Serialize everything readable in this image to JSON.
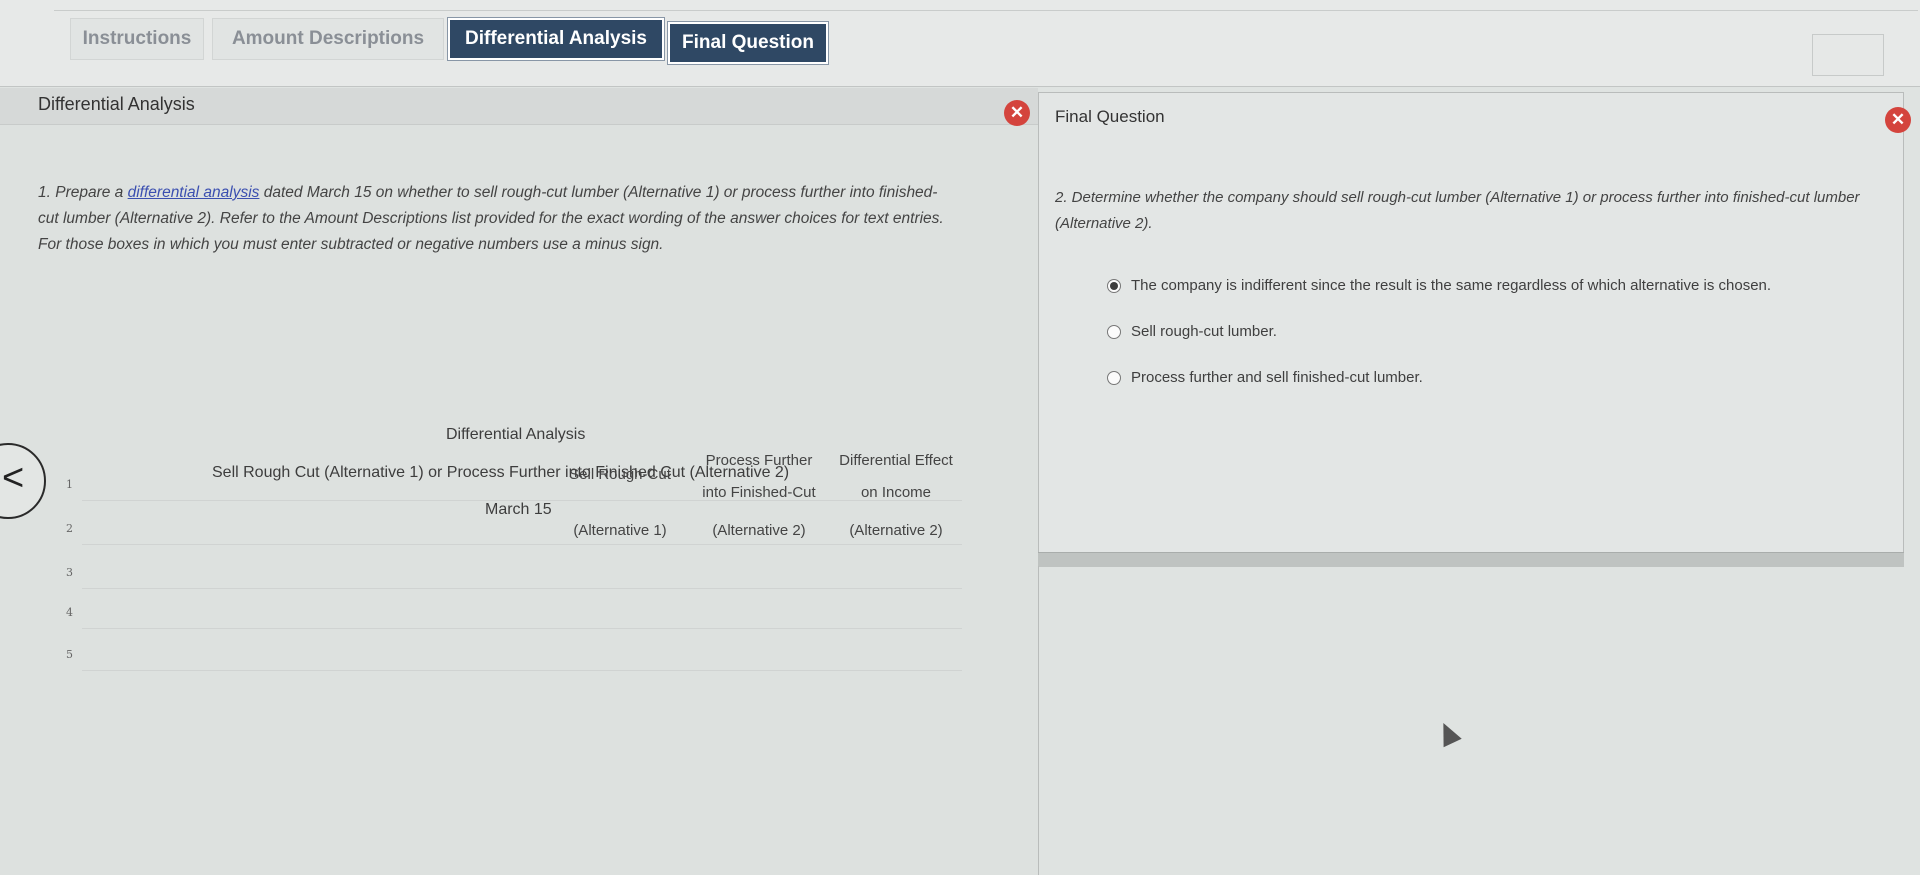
{
  "tabs": [
    {
      "label": "Instructions",
      "state": "inactive"
    },
    {
      "label": "Amount Descriptions",
      "state": "inactive"
    },
    {
      "label": "Differential Analysis",
      "state": "active"
    },
    {
      "label": "Final Question",
      "state": "active"
    }
  ],
  "left_panel": {
    "title": "Differential Analysis",
    "instructions": {
      "prefix": "1. Prepare a ",
      "link_text": "differential analysis",
      "line1_rest": " dated March 15 on whether to sell rough-cut lumber (Alternative 1) or process further into finished-",
      "line2": "cut lumber (Alternative 2). Refer to the Amount Descriptions list provided for the exact wording of the answer choices for text entries.",
      "line3": "For those boxes in which you must enter subtracted or negative numbers use a minus sign."
    },
    "report": {
      "title": "Differential Analysis",
      "subtitle": "Sell Rough Cut (Alternative 1) or Process Further into Finished Cut (Alternative 2)",
      "date": "March 15",
      "columns": [
        {
          "line1": "Sell Rough-Cut",
          "line2": "",
          "line3": "(Alternative 1)"
        },
        {
          "line1": "Process Further",
          "line2": "into Finished-Cut",
          "line3": "(Alternative 2)"
        },
        {
          "line1": "Differential Effect",
          "line2": "on Income",
          "line3": "(Alternative 2)"
        }
      ],
      "row_numbers": [
        "1",
        "2",
        "3",
        "4",
        "5"
      ]
    }
  },
  "right_panel": {
    "title": "Final Question",
    "question_line1": "2. Determine whether the company should sell rough-cut lumber (Alternative 1) or process further into finished-cut lumber",
    "question_line2": "(Alternative 2).",
    "options": [
      {
        "label": "The company is indifferent since the result is the same regardless of which alternative is chosen.",
        "selected": true
      },
      {
        "label": "Sell rough-cut lumber.",
        "selected": false
      },
      {
        "label": "Process further and sell finished-cut lumber.",
        "selected": false
      }
    ]
  },
  "icons": {
    "close": "close-icon",
    "back": "chevron-left-icon"
  },
  "colors": {
    "active_tab": "#2f4864",
    "close": "#d4443d",
    "link": "#3b4fb0"
  }
}
